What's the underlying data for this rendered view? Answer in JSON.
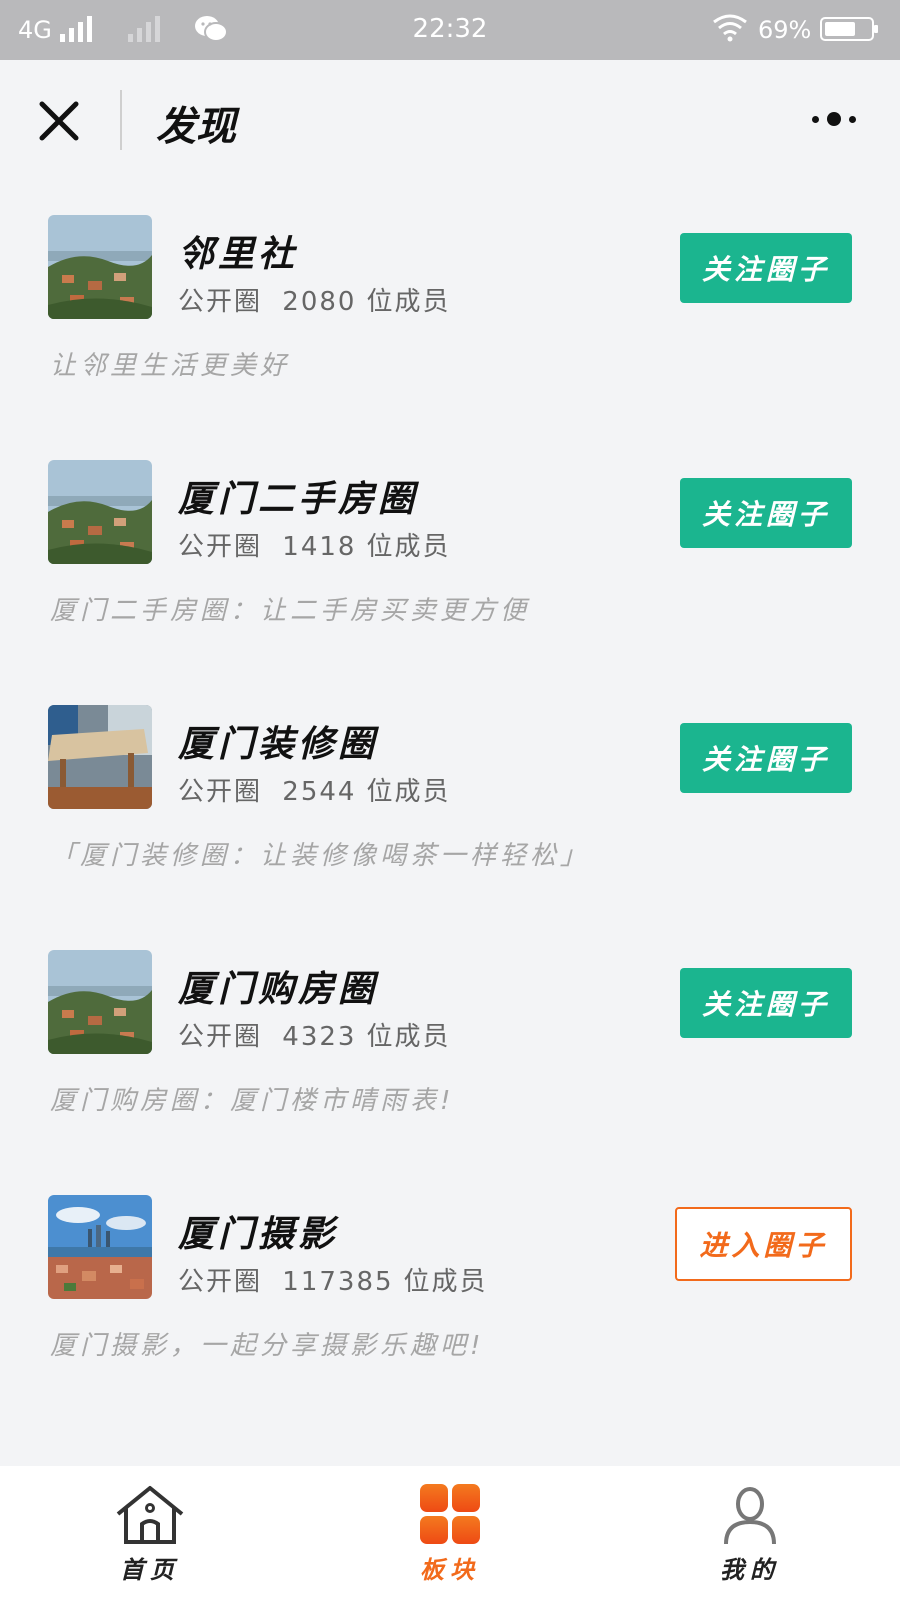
{
  "status_bar": {
    "network": "4G",
    "time": "22:32",
    "battery": "69%",
    "battery_level": 0.69
  },
  "nav": {
    "title": "发现",
    "close_icon": "close-icon",
    "more_icon": "more-icon"
  },
  "circles": [
    {
      "name": "邻里社",
      "type": "公开圈",
      "members": "2080",
      "members_suffix": "位成员",
      "description": "让邻里生活更美好",
      "action": "关注圈子",
      "action_style": "follow",
      "thumb": "coastal-town-photo"
    },
    {
      "name": "厦门二手房圈",
      "type": "公开圈",
      "members": "1418",
      "members_suffix": "位成员",
      "description": "厦门二手房圈：让二手房买卖更方便",
      "action": "关注圈子",
      "action_style": "follow",
      "thumb": "coastal-town-photo"
    },
    {
      "name": "厦门装修圈",
      "type": "公开圈",
      "members": "2544",
      "members_suffix": "位成员",
      "description": "「厦门装修圈：让装修像喝茶一样轻松」",
      "action": "关注圈子",
      "action_style": "follow",
      "thumb": "wooden-table-photo"
    },
    {
      "name": "厦门购房圈",
      "type": "公开圈",
      "members": "4323",
      "members_suffix": "位成员",
      "description": "厦门购房圈：厦门楼市晴雨表!",
      "action": "关注圈子",
      "action_style": "follow",
      "thumb": "coastal-town-photo"
    },
    {
      "name": "厦门摄影",
      "type": "公开圈",
      "members": "117385",
      "members_suffix": "位成员",
      "description": "厦门摄影，一起分享摄影乐趣吧!",
      "action": "进入圈子",
      "action_style": "enter",
      "thumb": "city-skyline-photo"
    }
  ],
  "tabs": [
    {
      "label": "首页",
      "icon": "home-icon",
      "active": false
    },
    {
      "label": "板块",
      "icon": "grid-icon",
      "active": true
    },
    {
      "label": "我的",
      "icon": "user-icon",
      "active": false
    }
  ],
  "colors": {
    "accent_green": "#1bb58f",
    "accent_orange": "#f26a1b",
    "background": "#f3f4f6"
  }
}
